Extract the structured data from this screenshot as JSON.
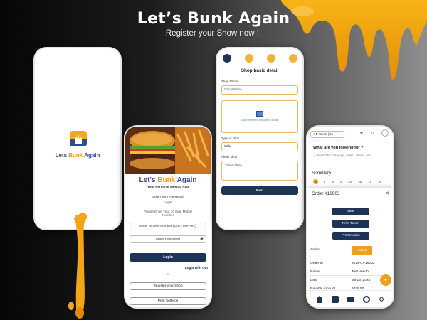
{
  "hero": {
    "title": "Let’s Bunk Again",
    "subtitle": "Register your Show now !!"
  },
  "colors": {
    "navy": "#1e3355",
    "orange": "#f0a01e",
    "blue_text": "#2b4f8e"
  },
  "splash": {
    "brand_a": "Lets ",
    "brand_b": "Bunk",
    "brand_c": " Again"
  },
  "login": {
    "brand_a": "Let's ",
    "brand_b": "Bunk",
    "brand_c": " Again",
    "tagline": "Your Personal Meetup App",
    "login_with_password": "Login With Password",
    "login_small": "Login",
    "instruction": "Please Enter Your 10 Digit Mobile Number",
    "mobile_placeholder": "Enter Mobile Number (Don't use +91)",
    "password_placeholder": "Enter Password",
    "login_button": "Login",
    "login_with_otp": "Login with Otp",
    "or": "or",
    "register_shop": "Register your Shop",
    "print_settings": "Print Settings"
  },
  "shop": {
    "heading": "Shop basic detail",
    "shop_name_label": "Shop Name",
    "shop_name_placeholder": "*Shop Name",
    "upload_text": "Shop the best to the user to upload",
    "type_label": "Type of shop",
    "type_value": "Cafe",
    "about_label": "About shop",
    "about_placeholder": "*About shop..",
    "next_button": "Next"
  },
  "dashboard": {
    "token_label": "E Token (On",
    "question": "What are you looking for ?",
    "search_placeholder": "Search for Category , order , combo , etc.",
    "summary_title": "Summary",
    "days": [
      "6",
      "7",
      "8",
      "9",
      "10",
      "16",
      "17",
      "18"
    ],
    "order_title": "Order #16003",
    "view_button": "View",
    "print_token_button": "Print Token",
    "print_invoice_button": "Print Invoice",
    "action_label": "Action",
    "action_button": "Action",
    "rows": [
      {
        "key": "Order Id",
        "value": "2024-07-19002"
      },
      {
        "key": "Name",
        "value": "Test Vendor"
      },
      {
        "key": "Date",
        "value": "Jul 19, 2024"
      },
      {
        "key": "Payable Amount",
        "value": "2029.50"
      }
    ],
    "fab_label": "+"
  }
}
